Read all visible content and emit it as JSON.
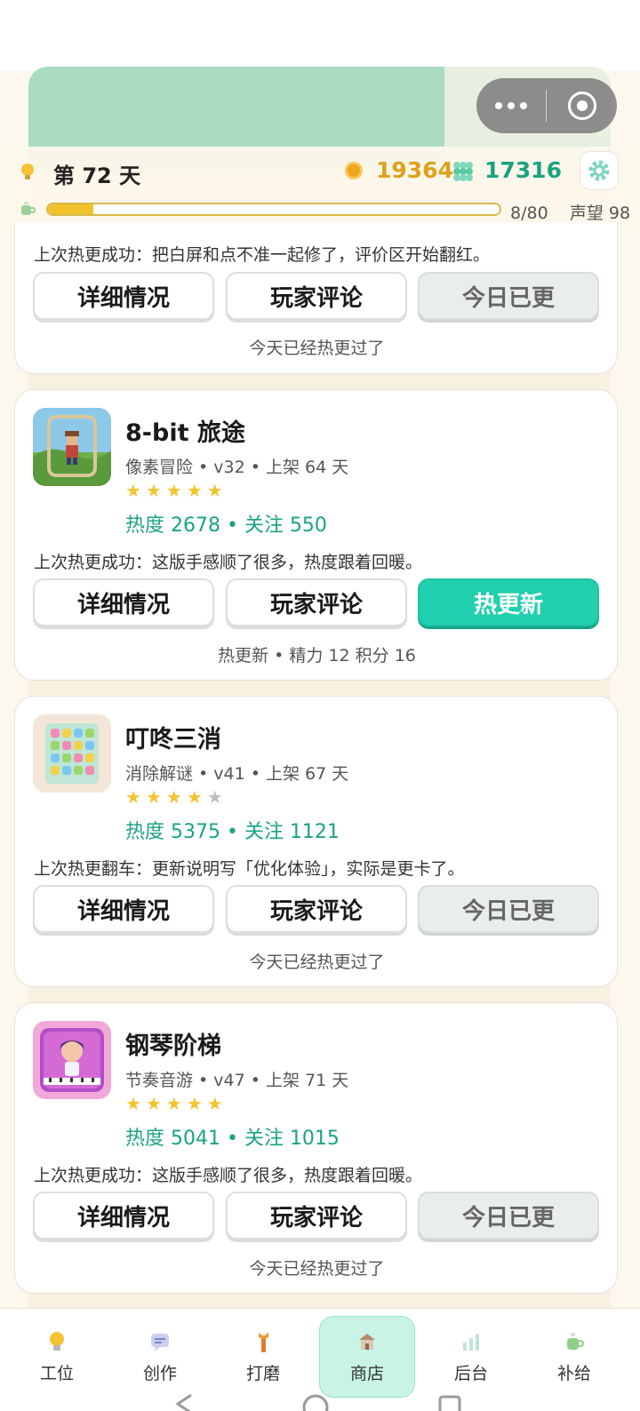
{
  "header": {
    "day_label": "第 72 天",
    "coins": "19364",
    "gems": "17316",
    "progress_fraction": 0.1,
    "progress_text": "8/80",
    "reputation_text": "声望 98"
  },
  "games": [
    {
      "last_update": "上次热更成功：把白屏和点不准一起修了，评价区开始翻红。",
      "buttons": [
        "详细情况",
        "玩家评论",
        "今日已更"
      ],
      "footnote": "今天已经热更过了"
    },
    {
      "title": "8-bit 旅途",
      "meta": "像素冒险 • v32 • 上架 64 天",
      "rating": 5,
      "stats": "热度 2678  •  关注 550",
      "last_update": "上次热更成功：这版手感顺了很多，热度跟着回暖。",
      "buttons": [
        "详细情况",
        "玩家评论",
        "热更新"
      ],
      "footnote": "热更新  •  精力 12  积分 16"
    },
    {
      "title": "叮咚三消",
      "meta": "消除解谜 • v41 • 上架 67 天",
      "rating": 4,
      "stats": "热度 5375  •  关注 1121",
      "last_update": "上次热更翻车：更新说明写「优化体验」，实际是更卡了。",
      "buttons": [
        "详细情况",
        "玩家评论",
        "今日已更"
      ],
      "footnote": "今天已经热更过了"
    },
    {
      "title": "钢琴阶梯",
      "meta": "节奏音游 • v47 • 上架 71 天",
      "rating": 5,
      "stats": "热度 5041  •  关注 1015",
      "last_update": "上次热更成功：这版手感顺了很多，热度跟着回暖。",
      "buttons": [
        "详细情况",
        "玩家评论",
        "今日已更"
      ],
      "footnote": "今天已经热更过了"
    }
  ],
  "tabs": [
    {
      "label": "工位",
      "icon": "lightbulb-icon"
    },
    {
      "label": "创作",
      "icon": "chat-bubble-icon"
    },
    {
      "label": "打磨",
      "icon": "wrench-icon"
    },
    {
      "label": "商店",
      "icon": "store-icon"
    },
    {
      "label": "后台",
      "icon": "bar-chart-icon"
    },
    {
      "label": "补给",
      "icon": "coffee-cup-icon"
    }
  ],
  "selected_tab": "商店",
  "colors": {
    "accent_teal": "#22cfae",
    "stat_green": "#1aa383",
    "coin_gold": "#e0a11c",
    "star_yellow": "#f4c430"
  }
}
